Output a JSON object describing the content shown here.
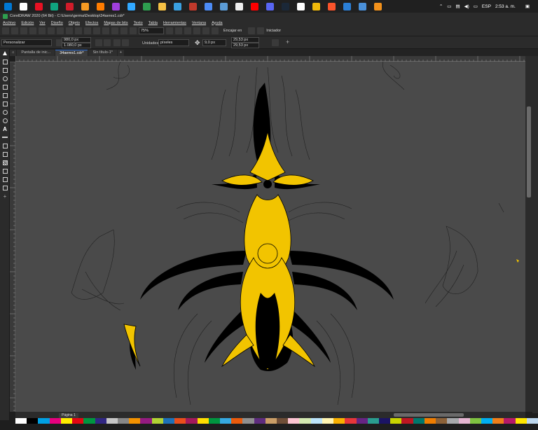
{
  "taskbar": {
    "icons": [
      {
        "name": "windows-start-icon",
        "color": "#0078d4"
      },
      {
        "name": "search-icon",
        "color": "#ffffff"
      },
      {
        "name": "app-icon-1",
        "color": "#e81123"
      },
      {
        "name": "app-icon-2",
        "color": "#10a37f"
      },
      {
        "name": "opera-icon",
        "color": "#d01c2a"
      },
      {
        "name": "app-icon-3",
        "color": "#f59a23"
      },
      {
        "name": "illustrator-icon",
        "color": "#ff7c00"
      },
      {
        "name": "animate-icon",
        "color": "#9f3fdc"
      },
      {
        "name": "photoshop-icon",
        "color": "#31a8ff"
      },
      {
        "name": "coreldraw-icon",
        "color": "#2e9e4f"
      },
      {
        "name": "file-explorer-icon",
        "color": "#f6c144"
      },
      {
        "name": "app-icon-4",
        "color": "#3aa0e0"
      },
      {
        "name": "app-icon-5",
        "color": "#c0392b"
      },
      {
        "name": "app-icon-6",
        "color": "#4c8bf5"
      },
      {
        "name": "app-icon-7",
        "color": "#5b9bd5"
      },
      {
        "name": "obs-icon",
        "color": "#eeeeee"
      },
      {
        "name": "youtube-icon",
        "color": "#ff0000"
      },
      {
        "name": "discord-icon",
        "color": "#5865f2"
      },
      {
        "name": "steam-icon",
        "color": "#1b2838"
      },
      {
        "name": "app-icon-8",
        "color": "#ffffff"
      },
      {
        "name": "binance-icon",
        "color": "#f0b90b"
      },
      {
        "name": "brave-icon",
        "color": "#fb542b"
      },
      {
        "name": "edge-icon",
        "color": "#2b7fd6"
      },
      {
        "name": "app-icon-9",
        "color": "#4a90d9"
      },
      {
        "name": "app-icon-10",
        "color": "#f2911b"
      }
    ],
    "language": "ESP",
    "time": "2:53 a. m."
  },
  "titlebar": {
    "title": "CorelDRAW 2020 (64 Bit) - C:\\Users\\germa\\Desktop\\34aeres1.cdr*"
  },
  "menu": [
    "Archivo",
    "Edición",
    "Ver",
    "Diseño",
    "Objeto",
    "Efectos",
    "Mapas de bits",
    "Texto",
    "Tabla",
    "Herramientas",
    "Ventana",
    "Ayuda"
  ],
  "toolbar": {
    "zoom": "75%",
    "snap": "Encajar en",
    "launch": "Iniciador"
  },
  "propbar": {
    "preset": "Personalizar",
    "width": "980,0 px",
    "height": "1.080,0 px",
    "units_label": "Unidades:",
    "units": "píxeles",
    "nudge": "9,0 px",
    "dup_x": "29,53 px",
    "dup_y": "29,53 px"
  },
  "tabs": [
    "Pantalla de inic...",
    "34aeres1.cdr*",
    "Sin título-1*"
  ],
  "page_tab": "Página 1",
  "colors": {
    "accent": "#2f6fd6",
    "canvas": "#4a4a4a",
    "artwork_yellow": "#f2c400",
    "artwork_black": "#000000"
  },
  "palette": [
    "#ffffff",
    "#000000",
    "#00a0e3",
    "#e6007e",
    "#ffed00",
    "#e30613",
    "#009640",
    "#312783",
    "#c6c6c6",
    "#878787",
    "#f39200",
    "#951b81",
    "#b2d234",
    "#1d71b8",
    "#e94e1b",
    "#a3195b",
    "#ffde00",
    "#00963f",
    "#36a9e1",
    "#ea5b0c",
    "#8f8f8f",
    "#5e2c7e",
    "#ca9e67",
    "#6f4e37",
    "#fcc4d2",
    "#d4e9b2",
    "#bce4fa",
    "#fff5b3",
    "#f9b000",
    "#e7363a",
    "#662483",
    "#2a9d8f",
    "#1b1464",
    "#c8d400",
    "#be1622",
    "#00786d",
    "#f07d00",
    "#8c6239",
    "#a7a9ac",
    "#e5b5d1",
    "#7fc241",
    "#00aeef",
    "#ef7f1a",
    "#b61a69",
    "#ffe600",
    "#bdd7ee"
  ]
}
